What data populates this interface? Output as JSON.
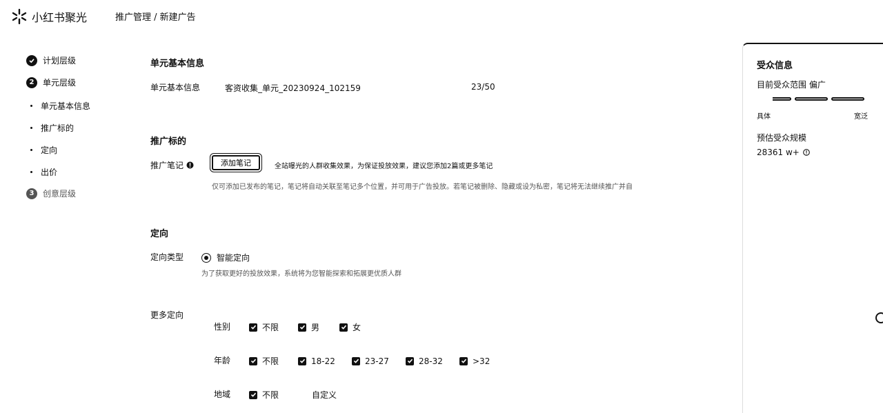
{
  "header": {
    "brand": "小红书聚光",
    "breadcrumb": "推广管理 / 新建广告"
  },
  "steps": [
    {
      "num": "1",
      "label": "计划层级"
    },
    {
      "num": "2",
      "label": "单元层级"
    },
    {
      "num": "3",
      "label": "创意层级"
    }
  ],
  "substeps": [
    "单元基本信息",
    "推广标的",
    "定向",
    "出价"
  ],
  "unit_info": {
    "section_title": "单元基本信息",
    "name_label": "单元基本信息",
    "name_value": "客资收集_单元_20230924_102159",
    "name_count": "23/50"
  },
  "target": {
    "section_title": "推广标的",
    "note_label": "推广笔记",
    "add_button": "添加笔记",
    "tip": "全站曝光的人群收集效果，为保证投放效果，建议您添加2篇或更多笔记",
    "hint": "仅可添加已发布的笔记，笔记将自动关联至笔记多个位置，并可用于广告投放。若笔记被删除、隐藏或设为私密，笔记将无法继续推广并自动下线。"
  },
  "direction": {
    "section_title": "定向",
    "type_label": "定向类型",
    "type_option": "智能定向",
    "type_hint": "为了获取更好的投放效果，系统将为您智能探索和拓展更优质人群",
    "more_label": "更多定向",
    "gender_label": "性别",
    "gender_options": [
      "不限",
      "男",
      "女"
    ],
    "age_label": "年龄",
    "age_options": [
      "不限",
      "18-22",
      "23-27",
      "28-32",
      ">32"
    ],
    "region_label": "地域",
    "region_option": "不限",
    "region_custom": "自定义"
  },
  "audience": {
    "title": "受众信息",
    "range_label": "目前受众范围 偏广",
    "scale_left": "具体",
    "scale_right": "宽泛",
    "estimate_label": "预估受众规模",
    "estimate_value": "28361 w+"
  },
  "icons": [
    "logo-sparkle-icon",
    "info-icon",
    "checkbox-checked-icon",
    "radio-selected-icon"
  ]
}
